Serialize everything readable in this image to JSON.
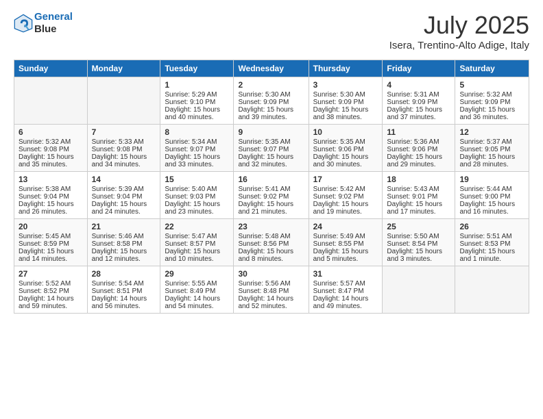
{
  "header": {
    "logo_line1": "General",
    "logo_line2": "Blue",
    "title": "July 2025",
    "subtitle": "Isera, Trentino-Alto Adige, Italy"
  },
  "days_of_week": [
    "Sunday",
    "Monday",
    "Tuesday",
    "Wednesday",
    "Thursday",
    "Friday",
    "Saturday"
  ],
  "weeks": [
    [
      {
        "day": "",
        "lines": []
      },
      {
        "day": "",
        "lines": []
      },
      {
        "day": "1",
        "lines": [
          "Sunrise: 5:29 AM",
          "Sunset: 9:10 PM",
          "Daylight: 15 hours",
          "and 40 minutes."
        ]
      },
      {
        "day": "2",
        "lines": [
          "Sunrise: 5:30 AM",
          "Sunset: 9:09 PM",
          "Daylight: 15 hours",
          "and 39 minutes."
        ]
      },
      {
        "day": "3",
        "lines": [
          "Sunrise: 5:30 AM",
          "Sunset: 9:09 PM",
          "Daylight: 15 hours",
          "and 38 minutes."
        ]
      },
      {
        "day": "4",
        "lines": [
          "Sunrise: 5:31 AM",
          "Sunset: 9:09 PM",
          "Daylight: 15 hours",
          "and 37 minutes."
        ]
      },
      {
        "day": "5",
        "lines": [
          "Sunrise: 5:32 AM",
          "Sunset: 9:09 PM",
          "Daylight: 15 hours",
          "and 36 minutes."
        ]
      }
    ],
    [
      {
        "day": "6",
        "lines": [
          "Sunrise: 5:32 AM",
          "Sunset: 9:08 PM",
          "Daylight: 15 hours",
          "and 35 minutes."
        ]
      },
      {
        "day": "7",
        "lines": [
          "Sunrise: 5:33 AM",
          "Sunset: 9:08 PM",
          "Daylight: 15 hours",
          "and 34 minutes."
        ]
      },
      {
        "day": "8",
        "lines": [
          "Sunrise: 5:34 AM",
          "Sunset: 9:07 PM",
          "Daylight: 15 hours",
          "and 33 minutes."
        ]
      },
      {
        "day": "9",
        "lines": [
          "Sunrise: 5:35 AM",
          "Sunset: 9:07 PM",
          "Daylight: 15 hours",
          "and 32 minutes."
        ]
      },
      {
        "day": "10",
        "lines": [
          "Sunrise: 5:35 AM",
          "Sunset: 9:06 PM",
          "Daylight: 15 hours",
          "and 30 minutes."
        ]
      },
      {
        "day": "11",
        "lines": [
          "Sunrise: 5:36 AM",
          "Sunset: 9:06 PM",
          "Daylight: 15 hours",
          "and 29 minutes."
        ]
      },
      {
        "day": "12",
        "lines": [
          "Sunrise: 5:37 AM",
          "Sunset: 9:05 PM",
          "Daylight: 15 hours",
          "and 28 minutes."
        ]
      }
    ],
    [
      {
        "day": "13",
        "lines": [
          "Sunrise: 5:38 AM",
          "Sunset: 9:04 PM",
          "Daylight: 15 hours",
          "and 26 minutes."
        ]
      },
      {
        "day": "14",
        "lines": [
          "Sunrise: 5:39 AM",
          "Sunset: 9:04 PM",
          "Daylight: 15 hours",
          "and 24 minutes."
        ]
      },
      {
        "day": "15",
        "lines": [
          "Sunrise: 5:40 AM",
          "Sunset: 9:03 PM",
          "Daylight: 15 hours",
          "and 23 minutes."
        ]
      },
      {
        "day": "16",
        "lines": [
          "Sunrise: 5:41 AM",
          "Sunset: 9:02 PM",
          "Daylight: 15 hours",
          "and 21 minutes."
        ]
      },
      {
        "day": "17",
        "lines": [
          "Sunrise: 5:42 AM",
          "Sunset: 9:02 PM",
          "Daylight: 15 hours",
          "and 19 minutes."
        ]
      },
      {
        "day": "18",
        "lines": [
          "Sunrise: 5:43 AM",
          "Sunset: 9:01 PM",
          "Daylight: 15 hours",
          "and 17 minutes."
        ]
      },
      {
        "day": "19",
        "lines": [
          "Sunrise: 5:44 AM",
          "Sunset: 9:00 PM",
          "Daylight: 15 hours",
          "and 16 minutes."
        ]
      }
    ],
    [
      {
        "day": "20",
        "lines": [
          "Sunrise: 5:45 AM",
          "Sunset: 8:59 PM",
          "Daylight: 15 hours",
          "and 14 minutes."
        ]
      },
      {
        "day": "21",
        "lines": [
          "Sunrise: 5:46 AM",
          "Sunset: 8:58 PM",
          "Daylight: 15 hours",
          "and 12 minutes."
        ]
      },
      {
        "day": "22",
        "lines": [
          "Sunrise: 5:47 AM",
          "Sunset: 8:57 PM",
          "Daylight: 15 hours",
          "and 10 minutes."
        ]
      },
      {
        "day": "23",
        "lines": [
          "Sunrise: 5:48 AM",
          "Sunset: 8:56 PM",
          "Daylight: 15 hours",
          "and 8 minutes."
        ]
      },
      {
        "day": "24",
        "lines": [
          "Sunrise: 5:49 AM",
          "Sunset: 8:55 PM",
          "Daylight: 15 hours",
          "and 5 minutes."
        ]
      },
      {
        "day": "25",
        "lines": [
          "Sunrise: 5:50 AM",
          "Sunset: 8:54 PM",
          "Daylight: 15 hours",
          "and 3 minutes."
        ]
      },
      {
        "day": "26",
        "lines": [
          "Sunrise: 5:51 AM",
          "Sunset: 8:53 PM",
          "Daylight: 15 hours",
          "and 1 minute."
        ]
      }
    ],
    [
      {
        "day": "27",
        "lines": [
          "Sunrise: 5:52 AM",
          "Sunset: 8:52 PM",
          "Daylight: 14 hours",
          "and 59 minutes."
        ]
      },
      {
        "day": "28",
        "lines": [
          "Sunrise: 5:54 AM",
          "Sunset: 8:51 PM",
          "Daylight: 14 hours",
          "and 56 minutes."
        ]
      },
      {
        "day": "29",
        "lines": [
          "Sunrise: 5:55 AM",
          "Sunset: 8:49 PM",
          "Daylight: 14 hours",
          "and 54 minutes."
        ]
      },
      {
        "day": "30",
        "lines": [
          "Sunrise: 5:56 AM",
          "Sunset: 8:48 PM",
          "Daylight: 14 hours",
          "and 52 minutes."
        ]
      },
      {
        "day": "31",
        "lines": [
          "Sunrise: 5:57 AM",
          "Sunset: 8:47 PM",
          "Daylight: 14 hours",
          "and 49 minutes."
        ]
      },
      {
        "day": "",
        "lines": []
      },
      {
        "day": "",
        "lines": []
      }
    ]
  ]
}
